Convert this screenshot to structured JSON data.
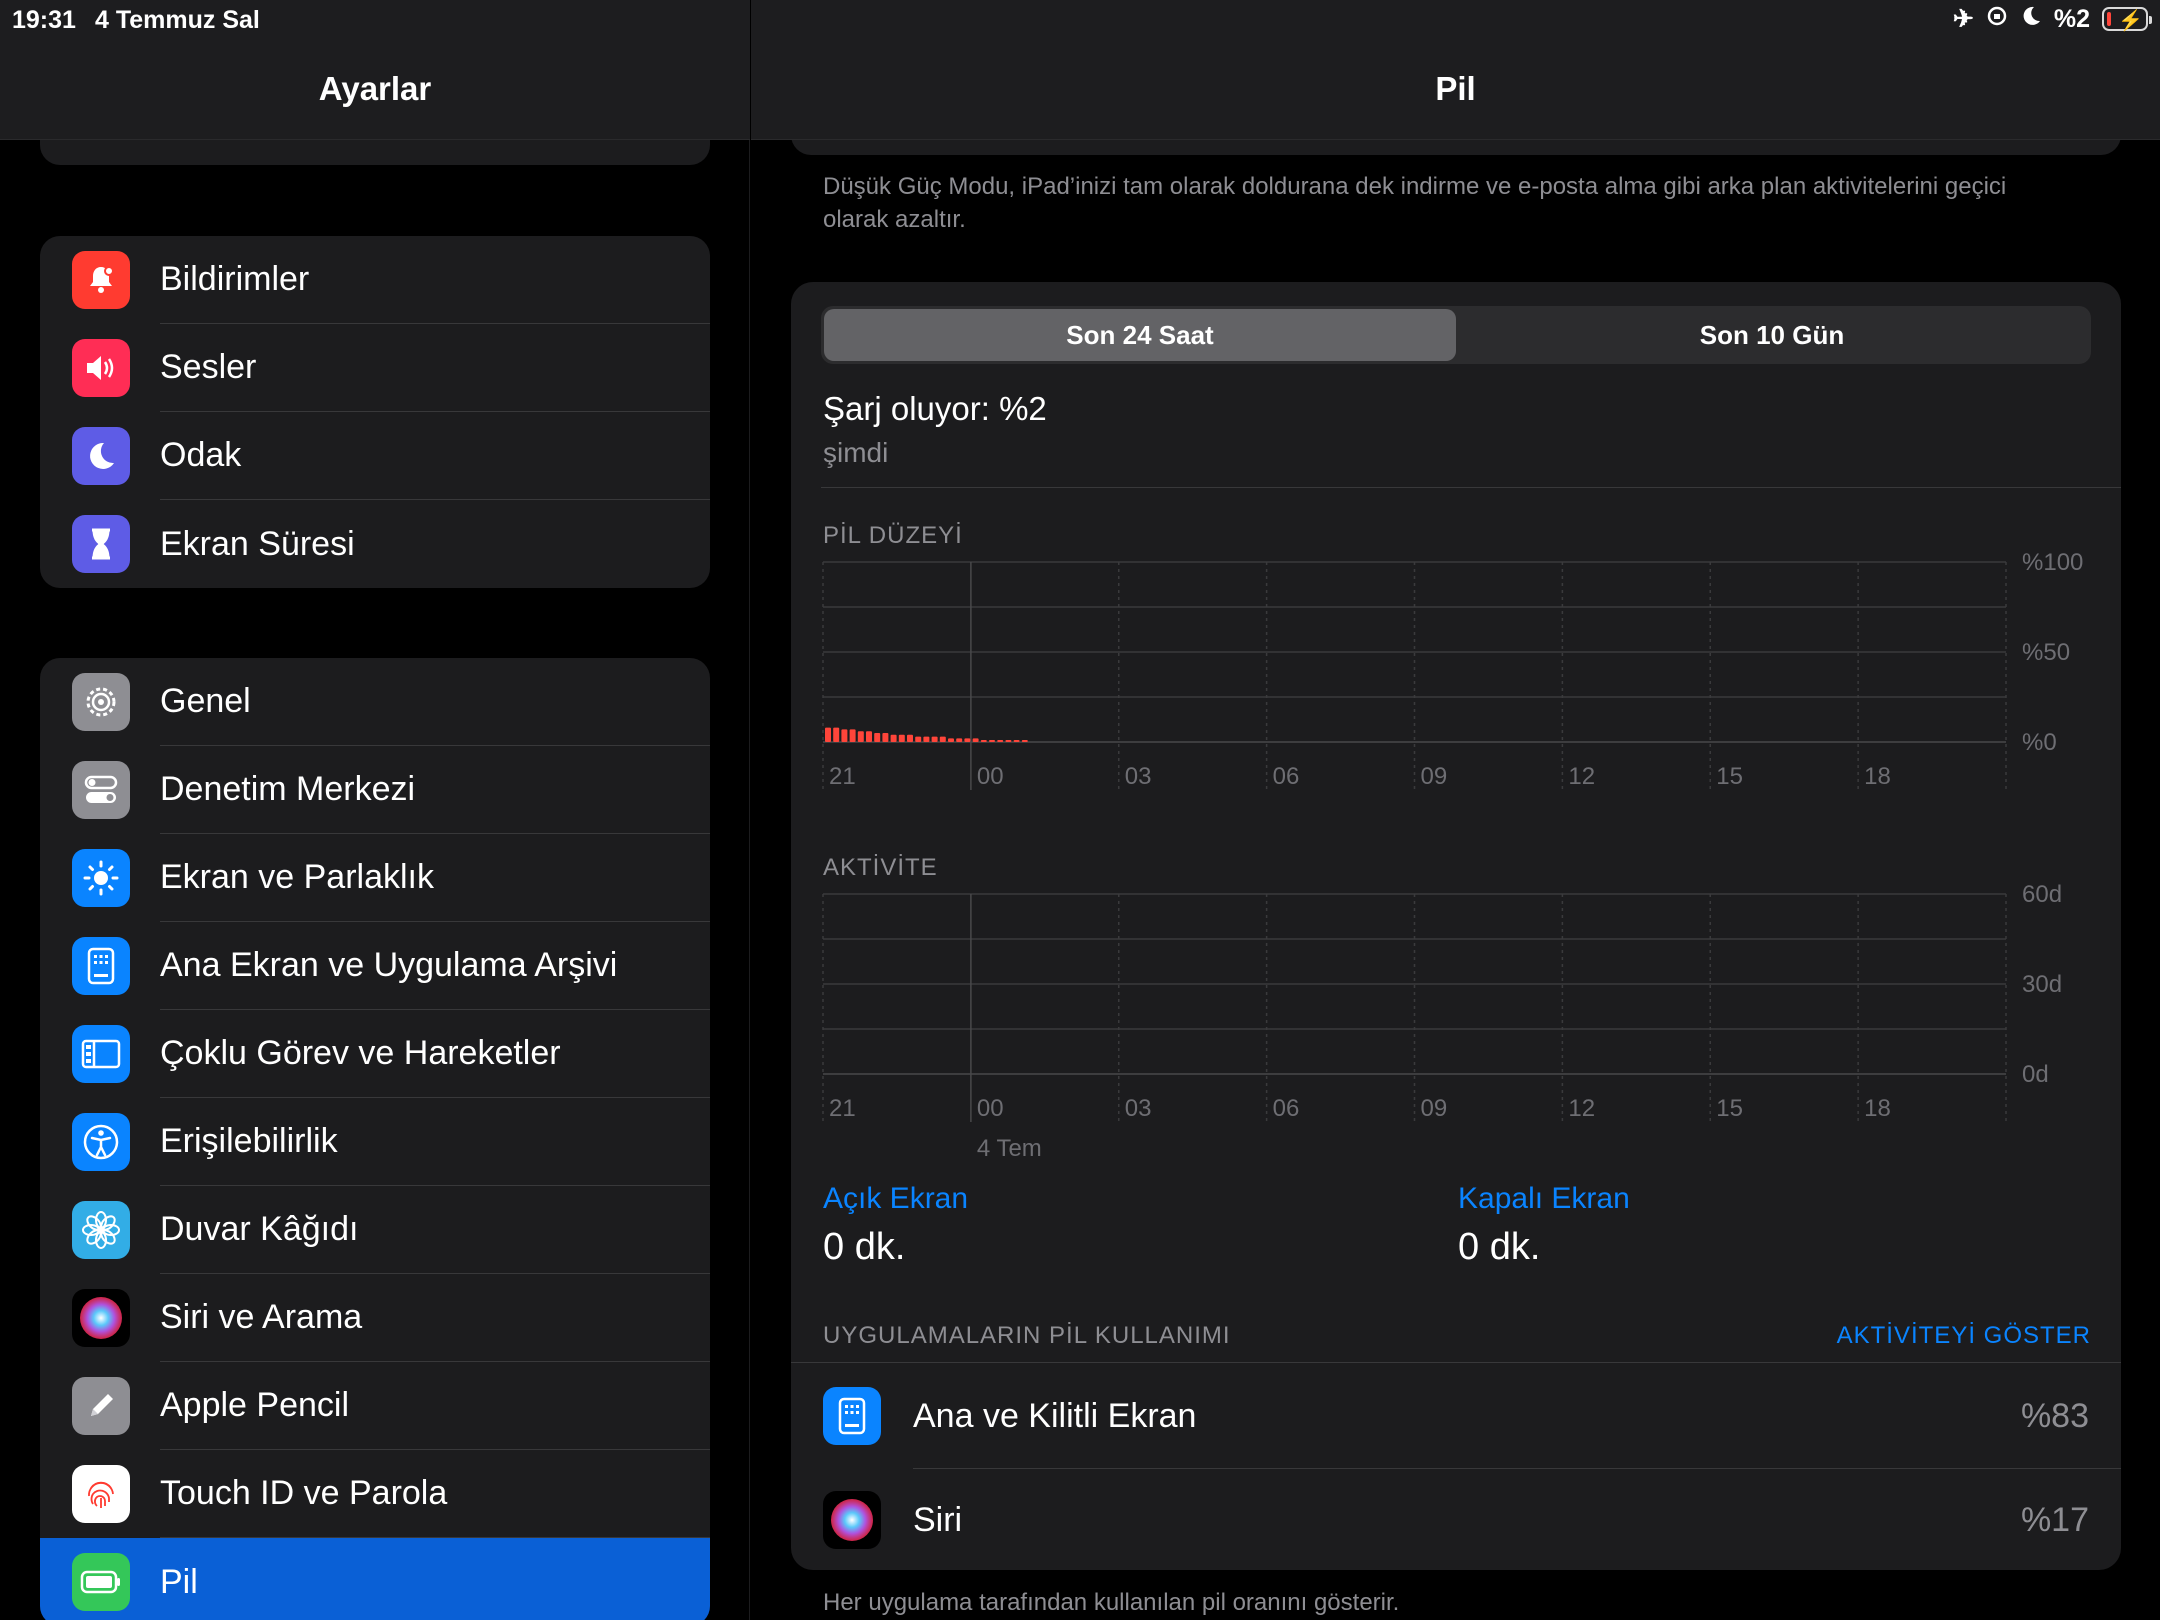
{
  "status": {
    "time": "19:31",
    "date": "4 Temmuz Sal",
    "battery_percent": "%2",
    "icons": [
      "airplane-icon",
      "orientation-lock-icon",
      "moon-icon",
      "battery-charging-icon"
    ]
  },
  "sidebar": {
    "title": "Ayarlar",
    "group1": [
      {
        "label": "Bildirimler",
        "icon": "bell-icon",
        "color": "#ff3b30"
      },
      {
        "label": "Sesler",
        "icon": "speaker-icon",
        "color": "#ff2d55"
      },
      {
        "label": "Odak",
        "icon": "moon-icon",
        "color": "#5e5ce6"
      },
      {
        "label": "Ekran Süresi",
        "icon": "hourglass-icon",
        "color": "#5e5ce6"
      }
    ],
    "group2": [
      {
        "label": "Genel",
        "icon": "gear-icon",
        "color": "#8e8e93"
      },
      {
        "label": "Denetim Merkezi",
        "icon": "toggles-icon",
        "color": "#8e8e93"
      },
      {
        "label": "Ekran ve Parlaklık",
        "icon": "sun-icon",
        "color": "#0a84ff"
      },
      {
        "label": "Ana Ekran ve Uygulama Arşivi",
        "icon": "home-screen-icon",
        "color": "#0a84ff"
      },
      {
        "label": "Çoklu Görev ve Hareketler",
        "icon": "multitasking-icon",
        "color": "#0a84ff"
      },
      {
        "label": "Erişilebilirlik",
        "icon": "accessibility-icon",
        "color": "#0a84ff"
      },
      {
        "label": "Duvar Kâğıdı",
        "icon": "flower-icon",
        "color": "#32ade6"
      },
      {
        "label": "Siri ve Arama",
        "icon": "siri-icon",
        "color": "#000000"
      },
      {
        "label": "Apple Pencil",
        "icon": "pencil-icon",
        "color": "#8e8e93"
      },
      {
        "label": "Touch ID ve Parola",
        "icon": "fingerprint-icon",
        "color": "#ffffff"
      },
      {
        "label": "Pil",
        "icon": "battery-icon",
        "color": "#34c759"
      }
    ]
  },
  "main": {
    "title": "Pil",
    "low_power_note": "Düşük Güç Modu, iPad’inizi tam olarak doldurana dek indirme ve e-posta alma gibi arka plan aktivitelerini geçici olarak azaltır.",
    "segments": [
      "Son 24 Saat",
      "Son 10 Gün"
    ],
    "active_segment": 0,
    "charge_title": "Şarj oluyor: %2",
    "charge_sub": "şimdi",
    "screen_on_label": "Açık Ekran",
    "screen_on_value": "0 dk.",
    "screen_off_label": "Kapalı Ekran",
    "screen_off_value": "0 dk.",
    "usage_header": "UYGULAMALARIN PİL KULLANIMI",
    "usage_link": "AKTİVİTEYİ GÖSTER",
    "apps": [
      {
        "name": "Ana ve Kilitli Ekran",
        "percent": "%83",
        "icon": "home-screen-icon"
      },
      {
        "name": "Siri",
        "percent": "%17",
        "icon": "siri-icon"
      }
    ],
    "usage_note": "Her uygulama tarafından kullanılan pil oranını gösterir."
  },
  "chart_data": [
    {
      "type": "bar",
      "title": "PİL DÜZEYİ",
      "x_ticks": [
        "21",
        "00",
        "03",
        "06",
        "09",
        "12",
        "15",
        "18"
      ],
      "y_ticks": [
        "%100",
        "%50",
        "%0"
      ],
      "ylim": [
        0,
        100
      ],
      "bar_color": "#ff453a",
      "values": [
        8,
        8,
        7,
        7,
        6,
        6,
        5,
        5,
        4,
        4,
        4,
        3,
        3,
        3,
        3,
        2,
        2,
        2,
        2,
        1,
        1,
        1,
        1,
        1,
        1
      ]
    },
    {
      "type": "bar",
      "title": "AKTİVİTE",
      "x_ticks": [
        "21",
        "00",
        "03",
        "06",
        "09",
        "12",
        "15",
        "18"
      ],
      "x_sub_label": "4 Tem",
      "y_ticks": [
        "60d",
        "30d",
        "0d"
      ],
      "ylim": [
        0,
        60
      ],
      "values": []
    }
  ]
}
